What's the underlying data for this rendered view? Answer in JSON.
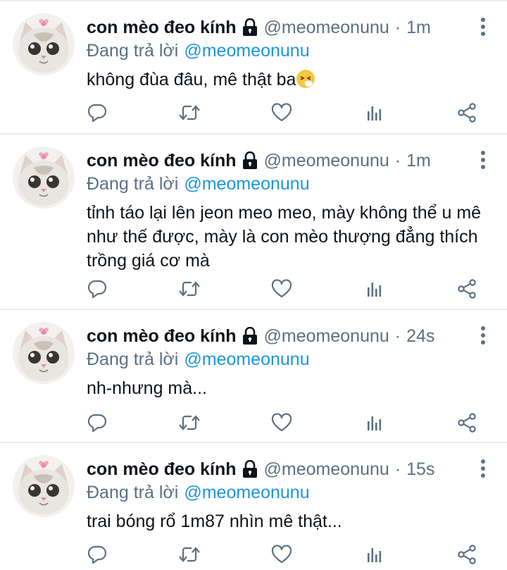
{
  "account": {
    "display_name": "con mèo đeo kính",
    "handle": "@meomeonunu",
    "reply_prefix": "Đang trả lời",
    "avatar_icon": "cat-avatar-icon",
    "lock_icon": "lock-icon"
  },
  "actions": [
    "reply-icon",
    "retweet-icon",
    "like-icon",
    "analytics-icon",
    "share-icon"
  ],
  "colors": {
    "text": "#0f1419",
    "secondary": "#5b7083",
    "mention": "#1b95e0",
    "divider": "#e6ecf0"
  },
  "tweets": [
    {
      "time": "1m",
      "text": "không đùa đâu, mê thật ba",
      "emoji": "sneezing-face-emoji"
    },
    {
      "time": "1m",
      "text": "tỉnh táo lại lên jeon meo meo, mày không thể u mê như thế được, mày là con mèo thượng đẳng thích trồng giá cơ mà"
    },
    {
      "time": "24s",
      "text": "nh-nhưng mà..."
    },
    {
      "time": "15s",
      "text": "trai bóng rổ 1m87 nhìn mê thật..."
    }
  ]
}
